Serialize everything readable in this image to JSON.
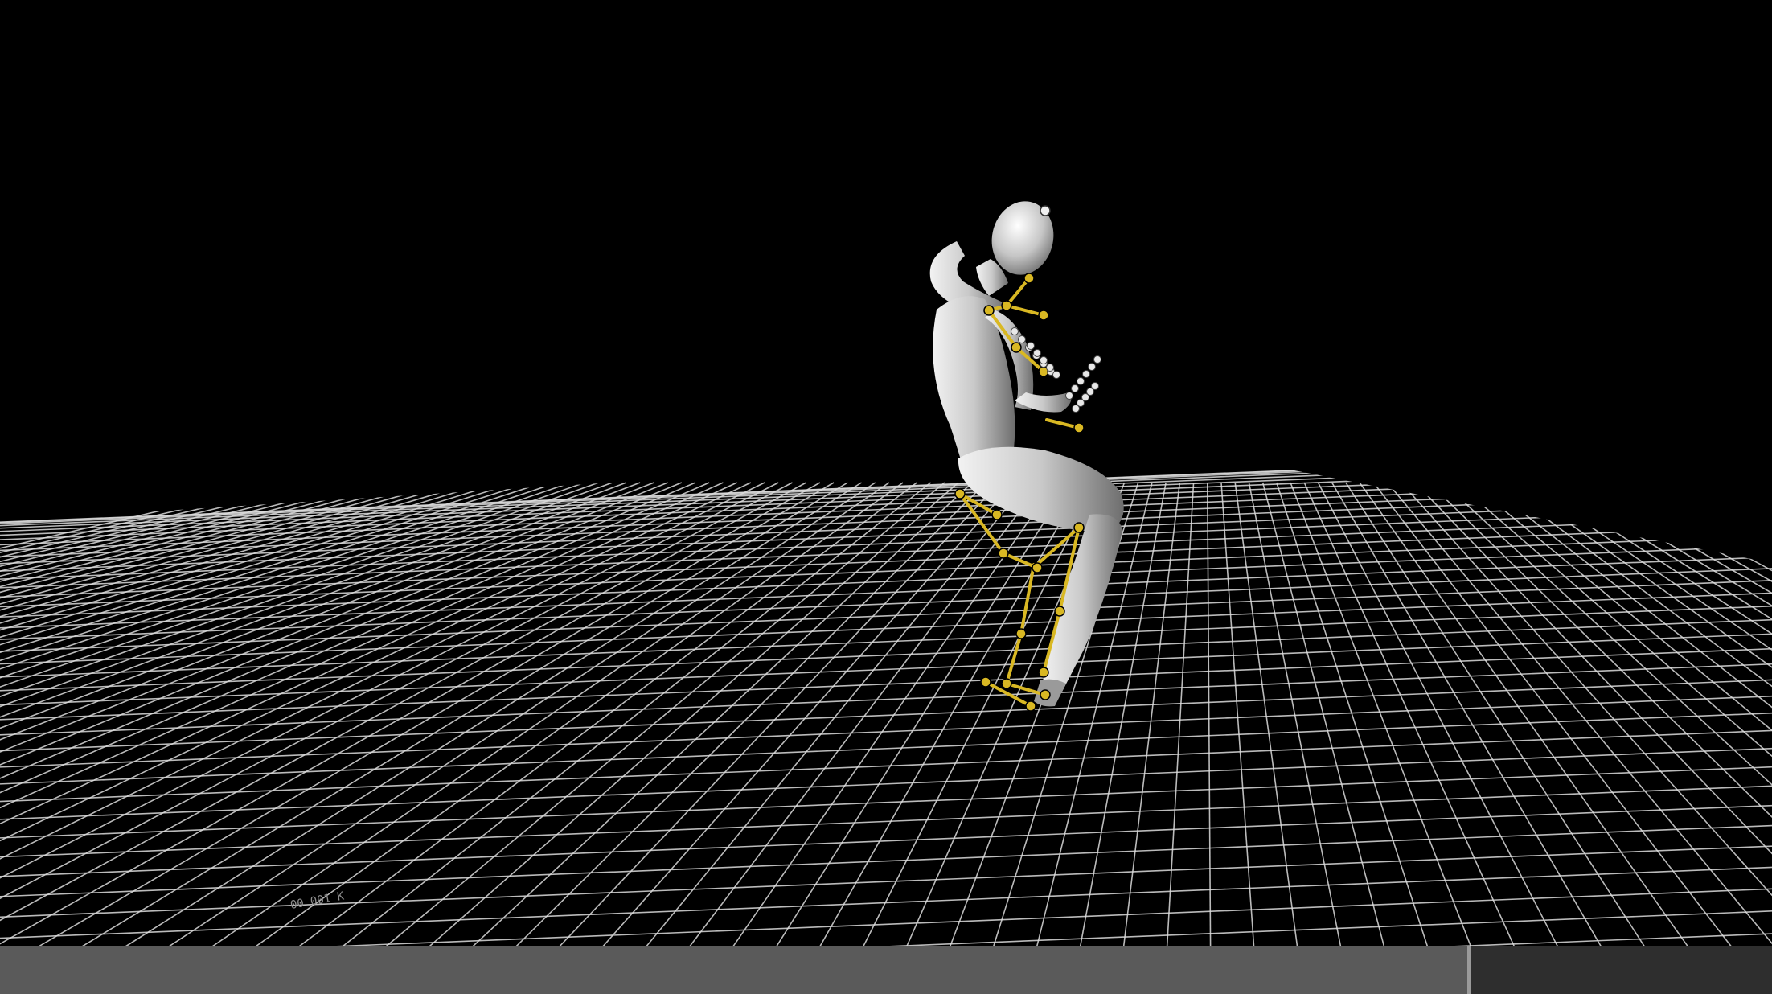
{
  "viewport": {
    "background": "#000000",
    "grid_color": "#dcdcdc",
    "body_color": "#c4c4c4",
    "rig_color": "#d9b823",
    "floor_label": "00 001 K"
  },
  "timeline": {
    "progress": 0.83,
    "track_color": "#2e2e2e",
    "fill_color": "#5a5a5a"
  }
}
